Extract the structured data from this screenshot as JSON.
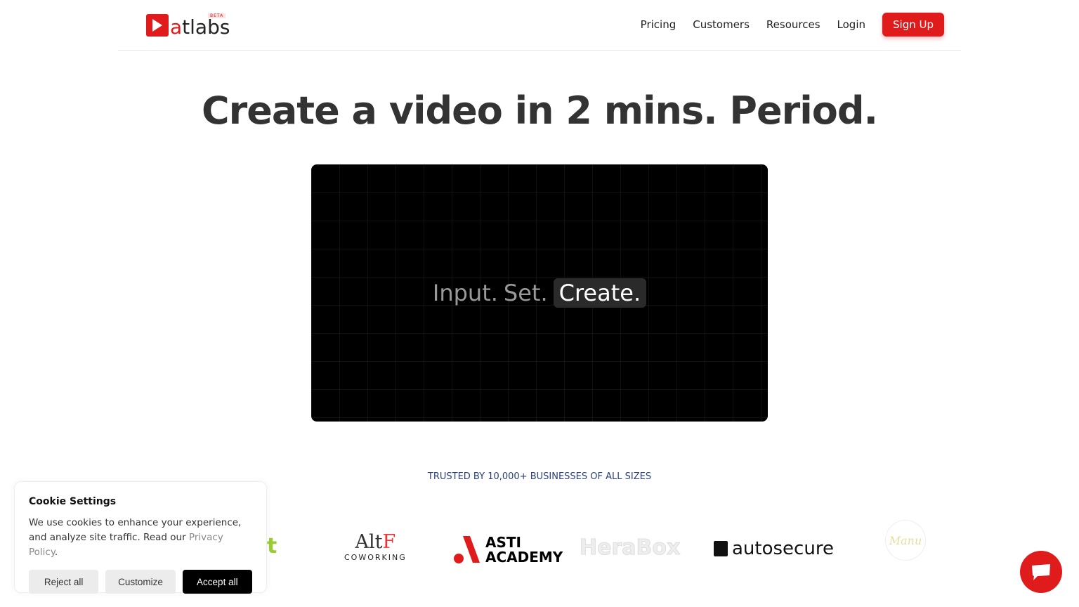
{
  "header": {
    "logo_text": "atlabs",
    "logo_badge": "BETA",
    "nav": [
      "Pricing",
      "Customers",
      "Resources",
      "Login"
    ],
    "signup": "Sign Up"
  },
  "hero": {
    "title": "Create a video in 2 mins. Period.",
    "video_text": [
      "Input.",
      "Set.",
      "Create."
    ]
  },
  "trusted": {
    "label": "TRUSTED BY 10,000+ BUSINESSES OF ALL SIZES",
    "logos": [
      "AltF COWORKING",
      "ASTI ACADEMY",
      "HeraBox",
      "autosecure",
      "Manu"
    ]
  },
  "cookie": {
    "title": "Cookie Settings",
    "text": "We use cookies to enhance your experience, and analyze site traffic. Read our ",
    "link": "Privacy Policy",
    "reject": "Reject all",
    "customize": "Customize",
    "accept": "Accept all"
  },
  "colors": {
    "brand": "#e01b1b",
    "trusted_text": "#2b3f7a"
  },
  "chat": {
    "icon": "chat-bubble-icon"
  }
}
